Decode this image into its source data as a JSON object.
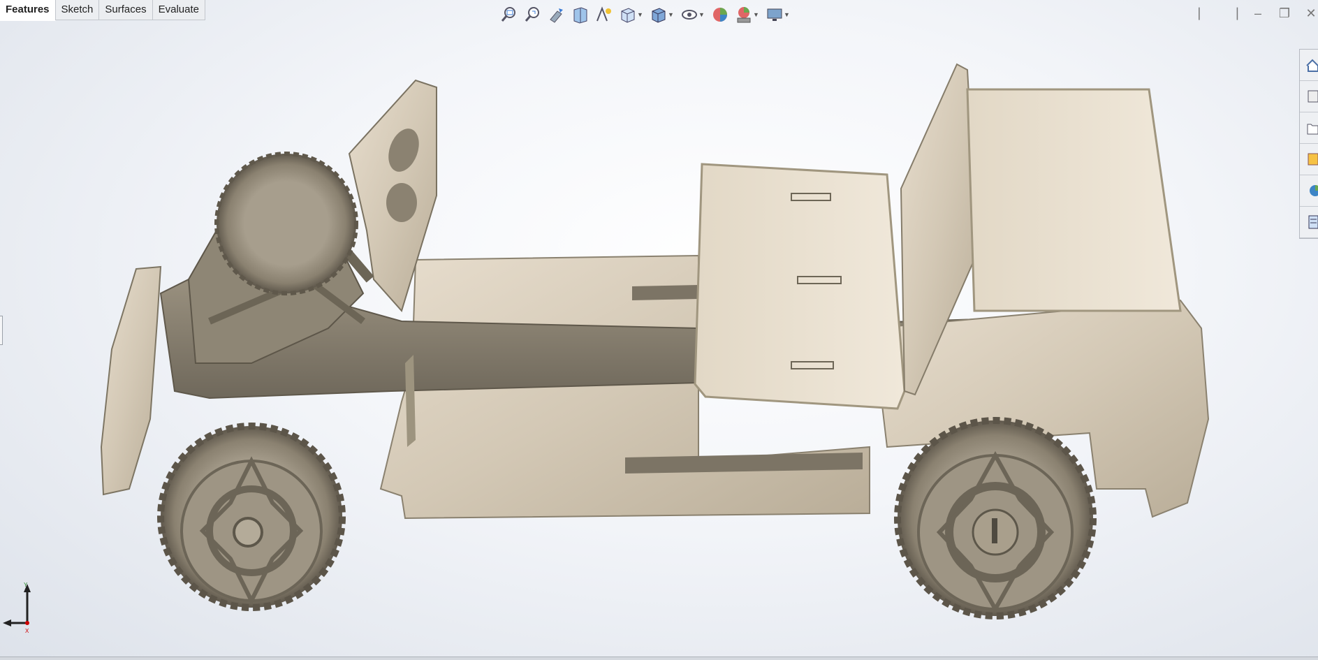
{
  "tabs": [
    {
      "label": "Features",
      "active": true
    },
    {
      "label": "Sketch",
      "active": false
    },
    {
      "label": "Surfaces",
      "active": false
    },
    {
      "label": "Evaluate",
      "active": false
    }
  ],
  "headsup_toolbar": {
    "icons": [
      "zoom-to-fit-icon",
      "zoom-to-area-icon",
      "previous-view-icon",
      "section-view-icon",
      "dynamic-annotation-icon",
      "view-orientation-icon",
      "display-style-icon",
      "hide-show-items-icon",
      "edit-appearance-icon",
      "apply-scene-icon",
      "view-settings-icon"
    ]
  },
  "triad": {
    "x_label": "X",
    "y_label": "Y"
  },
  "colors": {
    "wood": "#cfc4b2",
    "wood_dark": "#8c8474",
    "background_top": "#ffffff",
    "background_bottom": "#dde2ea"
  }
}
